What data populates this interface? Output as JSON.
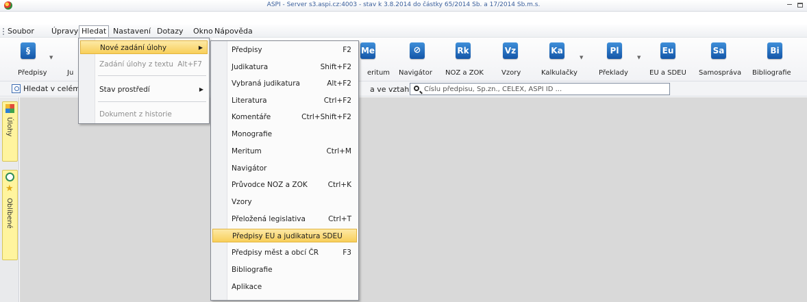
{
  "window": {
    "title": "ASPI - Server s3.aspi.cz:4003 - stav k 3.8.2014 do částky 65/2014 Sb. a 17/2014 Sb.m.s."
  },
  "menubar": {
    "items": [
      "Soubor",
      "Úpravy",
      "Hledat",
      "Nastavení",
      "Dotazy",
      "Okno",
      "Nápověda"
    ],
    "active": "Hledat"
  },
  "toolbar": {
    "predpisy": {
      "icon": "§",
      "label": "Předpisy"
    },
    "judikatura": {
      "label": "Ju"
    },
    "meritum": {
      "icon": "Me",
      "label": "eritum"
    },
    "navigator": {
      "icon": "compass-icon",
      "label": "Navigátor"
    },
    "noz": {
      "icon": "Rk",
      "label": "NOZ a ZOK"
    },
    "vzory": {
      "icon": "Vz",
      "label": "Vzory"
    },
    "kalkulacky": {
      "icon": "Ka",
      "label": "Kalkulačky"
    },
    "preklady": {
      "icon": "Pl",
      "label": "Překlady"
    },
    "eu": {
      "icon": "Eu",
      "label": "EU a SDEU"
    },
    "samosprava": {
      "icon": "Sa",
      "label": "Samospráva"
    },
    "bibliografie": {
      "icon": "Bi",
      "label": "Bibliografie"
    }
  },
  "searchbar": {
    "search_in_label": "Hledat v celém",
    "relation_label": "a ve vztahu k",
    "placeholder": "Číslu předpisu, Sp.zn., CELEX, ASPI ID ..."
  },
  "sidebar": {
    "tasks_label": "Úlohy",
    "favorites_label": "Oblíbené"
  },
  "hledat_menu": {
    "items": [
      {
        "label": "Nové zadání úlohy",
        "submenu": true,
        "highlighted": true
      },
      {
        "label": "Zadání úlohy z textu",
        "shortcut": "Alt+F7",
        "disabled": true
      },
      {
        "label": "Stav prostředí",
        "submenu": true
      },
      {
        "label": "Dokument z historie",
        "disabled": true
      }
    ]
  },
  "submenu": {
    "items": [
      {
        "label": "Předpisy",
        "shortcut": "F2"
      },
      {
        "label": "Judikatura",
        "shortcut": "Shift+F2"
      },
      {
        "label": "Vybraná judikatura",
        "shortcut": "Alt+F2"
      },
      {
        "label": "Literatura",
        "shortcut": "Ctrl+F2"
      },
      {
        "label": "Komentáře",
        "shortcut": "Ctrl+Shift+F2"
      },
      {
        "label": "Monografie",
        "shortcut": ""
      },
      {
        "label": "Meritum",
        "shortcut": "Ctrl+M"
      },
      {
        "label": "Navigátor",
        "shortcut": ""
      },
      {
        "label": "Průvodce NOZ a ZOK",
        "shortcut": "Ctrl+K"
      },
      {
        "label": "Vzory",
        "shortcut": ""
      },
      {
        "label": "Přeložená legislativa",
        "shortcut": "Ctrl+T"
      },
      {
        "label": "Předpisy EU a judikatura SDEU",
        "shortcut": "",
        "highlighted": true
      },
      {
        "label": "Předpisy měst a obcí ČR",
        "shortcut": "F3"
      },
      {
        "label": "Bibliografie",
        "shortcut": ""
      },
      {
        "label": "Aplikace",
        "shortcut": ""
      }
    ]
  },
  "colors": {
    "highlight": "#f8cf5a",
    "icon_blue": "#1456a8",
    "sidebar_tab": "#fff49e",
    "workspace": "#d9d9d9"
  }
}
